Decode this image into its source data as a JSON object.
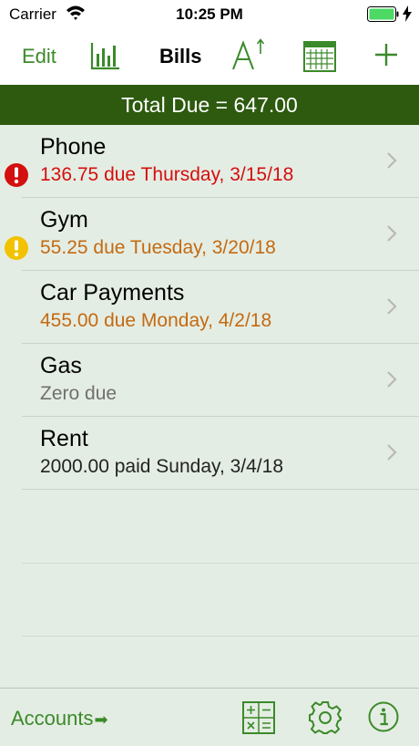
{
  "status_bar": {
    "carrier": "Carrier",
    "time": "10:25 PM"
  },
  "nav": {
    "edit_label": "Edit",
    "title": "Bills"
  },
  "total": {
    "text": "Total Due = 647.00"
  },
  "bills": [
    {
      "name": "Phone",
      "status": "136.75 due Thursday, 3/15/18",
      "state": "overdue"
    },
    {
      "name": "Gym",
      "status": "55.25 due Tuesday, 3/20/18",
      "state": "due-soon"
    },
    {
      "name": "Car Payments",
      "status": "455.00 due Monday, 4/2/18",
      "state": "due"
    },
    {
      "name": "Gas",
      "status": "Zero due",
      "state": "zero"
    },
    {
      "name": "Rent",
      "status": "2000.00 paid Sunday, 3/4/18",
      "state": "paid"
    }
  ],
  "bottom": {
    "accounts_label": "Accounts"
  },
  "colors": {
    "accent": "#3b8a2a",
    "header": "#2d5a0f",
    "list_bg": "#e4ede3",
    "overdue": "#d40f0f",
    "due": "#c46a12",
    "warning": "#f2c200"
  },
  "icons": [
    "wifi-icon",
    "battery-icon",
    "chart-icon",
    "sort-icon",
    "calendar-icon",
    "add-icon",
    "chevron-right-icon",
    "alert-icon",
    "warning-icon",
    "calculator-icon",
    "gear-icon",
    "info-icon",
    "arrow-right-icon"
  ]
}
